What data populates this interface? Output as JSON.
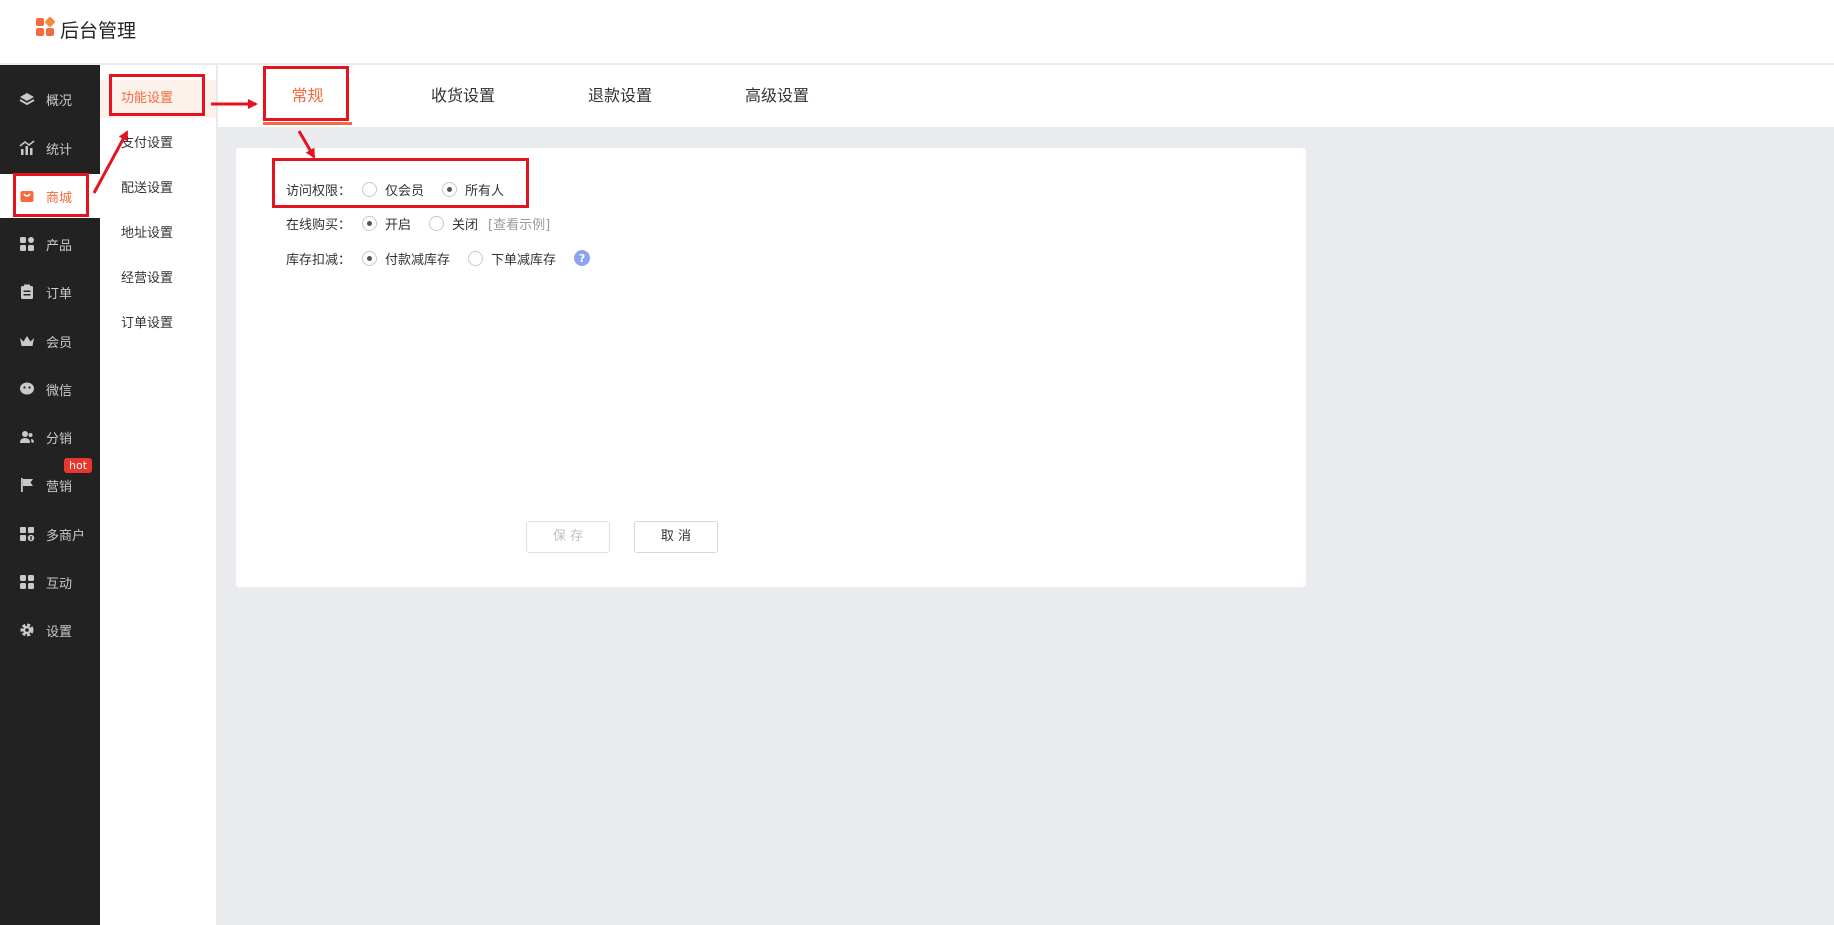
{
  "app": {
    "title": "后台管理"
  },
  "sidebar": {
    "items": [
      {
        "label": "概况",
        "icon": "layers-icon"
      },
      {
        "label": "统计",
        "icon": "chart-icon"
      },
      {
        "label": "商城",
        "icon": "shop-bag-icon",
        "active": true
      },
      {
        "label": "产品",
        "icon": "grid-icon"
      },
      {
        "label": "订单",
        "icon": "clipboard-icon"
      },
      {
        "label": "会员",
        "icon": "crown-icon"
      },
      {
        "label": "微信",
        "icon": "wechat-icon"
      },
      {
        "label": "分销",
        "icon": "users-icon"
      },
      {
        "label": "营销",
        "icon": "flag-icon"
      },
      {
        "label": "多商户",
        "icon": "store-grid-icon"
      },
      {
        "label": "互动",
        "icon": "interact-icon"
      },
      {
        "label": "设置",
        "icon": "gear-icon"
      }
    ],
    "hot_badge": "hot"
  },
  "submenu": {
    "items": [
      {
        "label": "功能设置",
        "active": true
      },
      {
        "label": "支付设置"
      },
      {
        "label": "配送设置"
      },
      {
        "label": "地址设置"
      },
      {
        "label": "经营设置"
      },
      {
        "label": "订单设置"
      }
    ]
  },
  "tabs": [
    {
      "label": "常规",
      "active": true
    },
    {
      "label": "收货设置"
    },
    {
      "label": "退款设置"
    },
    {
      "label": "高级设置"
    }
  ],
  "form": {
    "access": {
      "label": "访问权限：",
      "options": [
        "仅会员",
        "所有人"
      ],
      "selected": "所有人"
    },
    "online_buy": {
      "label": "在线购买：",
      "options": [
        "开启",
        "关闭"
      ],
      "selected": "开启",
      "example_link": "[查看示例]"
    },
    "stock": {
      "label": "库存扣减：",
      "options": [
        "付款减库存",
        "下单减库存"
      ],
      "selected": "付款减库存",
      "help": "?"
    }
  },
  "buttons": {
    "save": "保 存",
    "cancel": "取 消"
  },
  "colors": {
    "accent": "#f46a3e",
    "sidebar_bg": "#222222",
    "annotation": "#e3131f"
  }
}
